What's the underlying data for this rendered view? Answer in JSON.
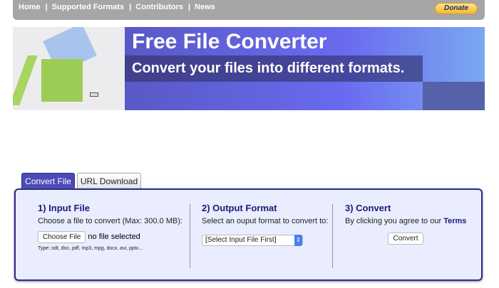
{
  "nav": {
    "links": [
      "Home",
      "Supported Formats",
      "Contributors",
      "News"
    ],
    "separator": "|",
    "donate": "Donate"
  },
  "banner": {
    "title": "Free File Converter",
    "subtitle": "Convert your files into different formats."
  },
  "tabs": [
    {
      "label": "Convert File",
      "active": true
    },
    {
      "label": "URL Download",
      "active": false
    }
  ],
  "input": {
    "heading": "1) Input File",
    "desc": "Choose a file to convert (Max: 300.0 MB):",
    "choose_button": "Choose File",
    "status": "no file selected",
    "types": "Type: odt, doc, pdf, mp3, mpg, docx, avi, pptx..."
  },
  "output": {
    "heading": "2) Output Format",
    "desc": "Select an ouput format to convert to:",
    "select_value": "[Select Input File First]"
  },
  "convert": {
    "heading": "3) Convert",
    "desc": "By clicking you agree to our",
    "terms_link": "Terms",
    "button": "Convert"
  },
  "colors": {
    "accent": "#2a2a8a",
    "panel": "#e9edfd",
    "tab_active": "#4a4ab8"
  }
}
